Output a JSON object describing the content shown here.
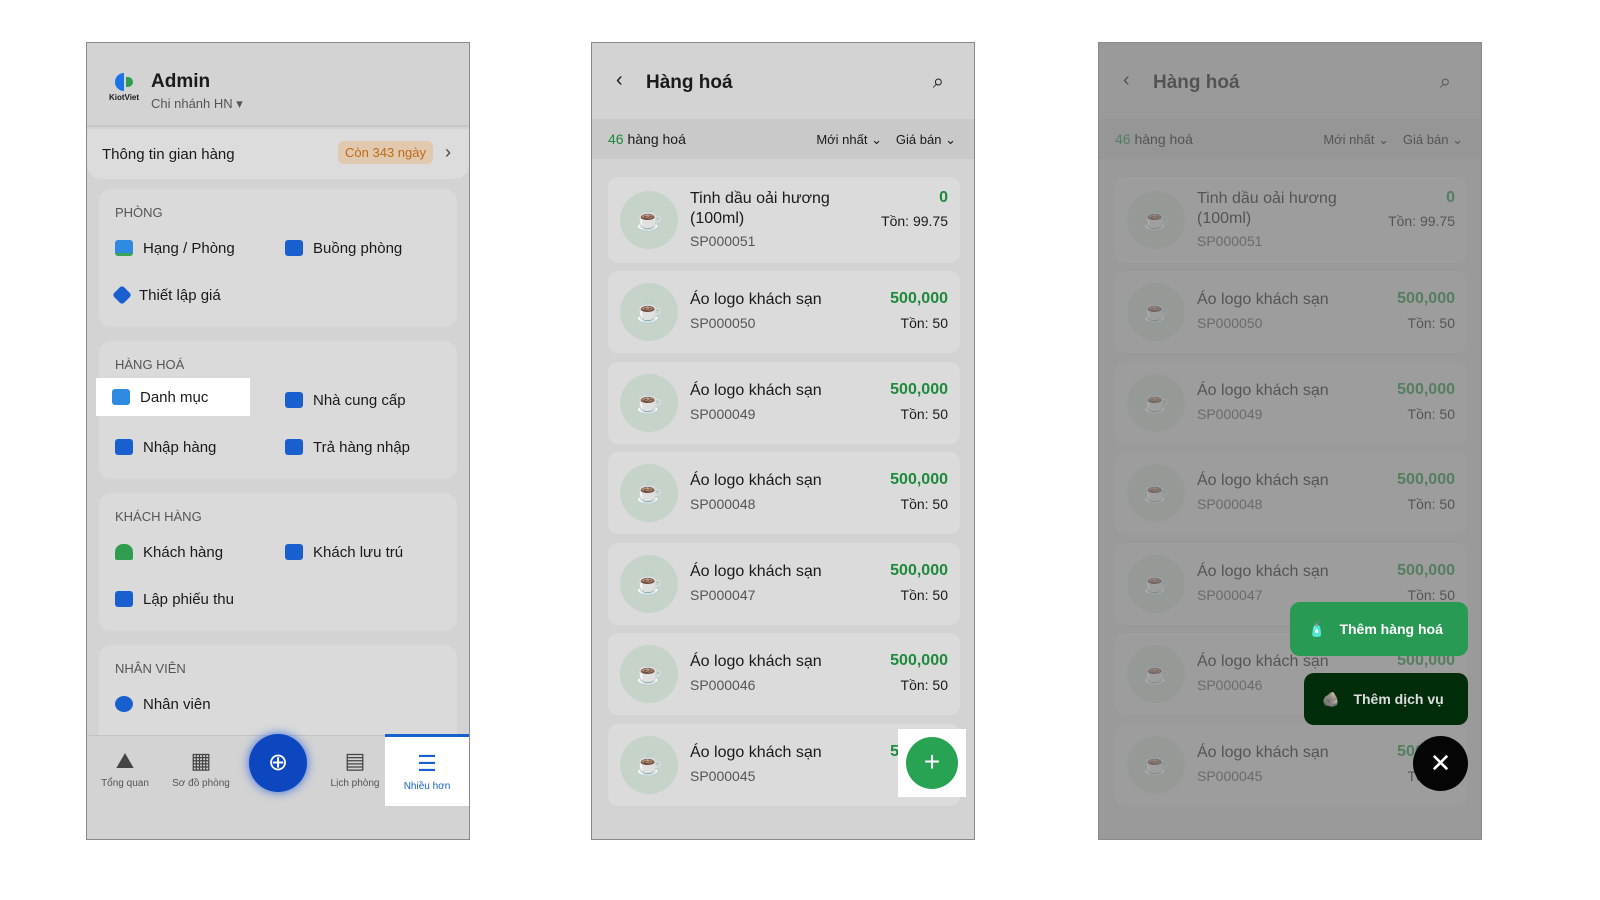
{
  "more": {
    "brand": "KiotViet",
    "user": "Admin",
    "branch": "Chi nhánh HN",
    "store_info": "Thông tin gian hàng",
    "remaining": "Còn 343 ngày",
    "sections": [
      {
        "title": "PHÒNG",
        "items": [
          "Hạng / Phòng",
          "Buồng phòng",
          "Thiết lập giá"
        ]
      },
      {
        "title": "HÀNG HOÁ",
        "items": [
          "Danh mục",
          "Nhà cung cấp",
          "Nhập hàng",
          "Trả hàng nhập"
        ]
      },
      {
        "title": "KHÁCH HÀNG",
        "items": [
          "Khách hàng",
          "Khách lưu trú",
          "Lập phiếu thu"
        ]
      },
      {
        "title": "NHÂN VIÊN",
        "items": [
          "Nhân viên"
        ]
      }
    ],
    "nav": [
      "Tổng quan",
      "Sơ đồ phòng",
      "Lịch phòng",
      "Nhiều hơn"
    ]
  },
  "goods": {
    "title": "Hàng hoá",
    "count": "46",
    "count_label": "hàng hoá",
    "sort": "Mới nhất",
    "price_filter": "Giá bán",
    "items": [
      {
        "name": "Tinh dầu oải hương (100ml)",
        "code": "SP000051",
        "price": "0",
        "stock": "Tồn: 99.75"
      },
      {
        "name": "Áo logo khách sạn",
        "code": "SP000050",
        "price": "500,000",
        "stock": "Tồn: 50"
      },
      {
        "name": "Áo logo khách sạn",
        "code": "SP000049",
        "price": "500,000",
        "stock": "Tồn: 50"
      },
      {
        "name": "Áo logo khách sạn",
        "code": "SP000048",
        "price": "500,000",
        "stock": "Tồn: 50"
      },
      {
        "name": "Áo logo khách sạn",
        "code": "SP000047",
        "price": "500,000",
        "stock": "Tồn: 50"
      },
      {
        "name": "Áo logo khách sạn",
        "code": "SP000046",
        "price": "500,000",
        "stock": "Tồn: 50"
      },
      {
        "name": "Áo logo khách sạn",
        "code": "SP000045",
        "price": "500,000",
        "stock": "Tồn: 50"
      }
    ]
  },
  "actions": {
    "add_goods": "Thêm hàng hoá",
    "add_service": "Thêm dịch vụ"
  }
}
